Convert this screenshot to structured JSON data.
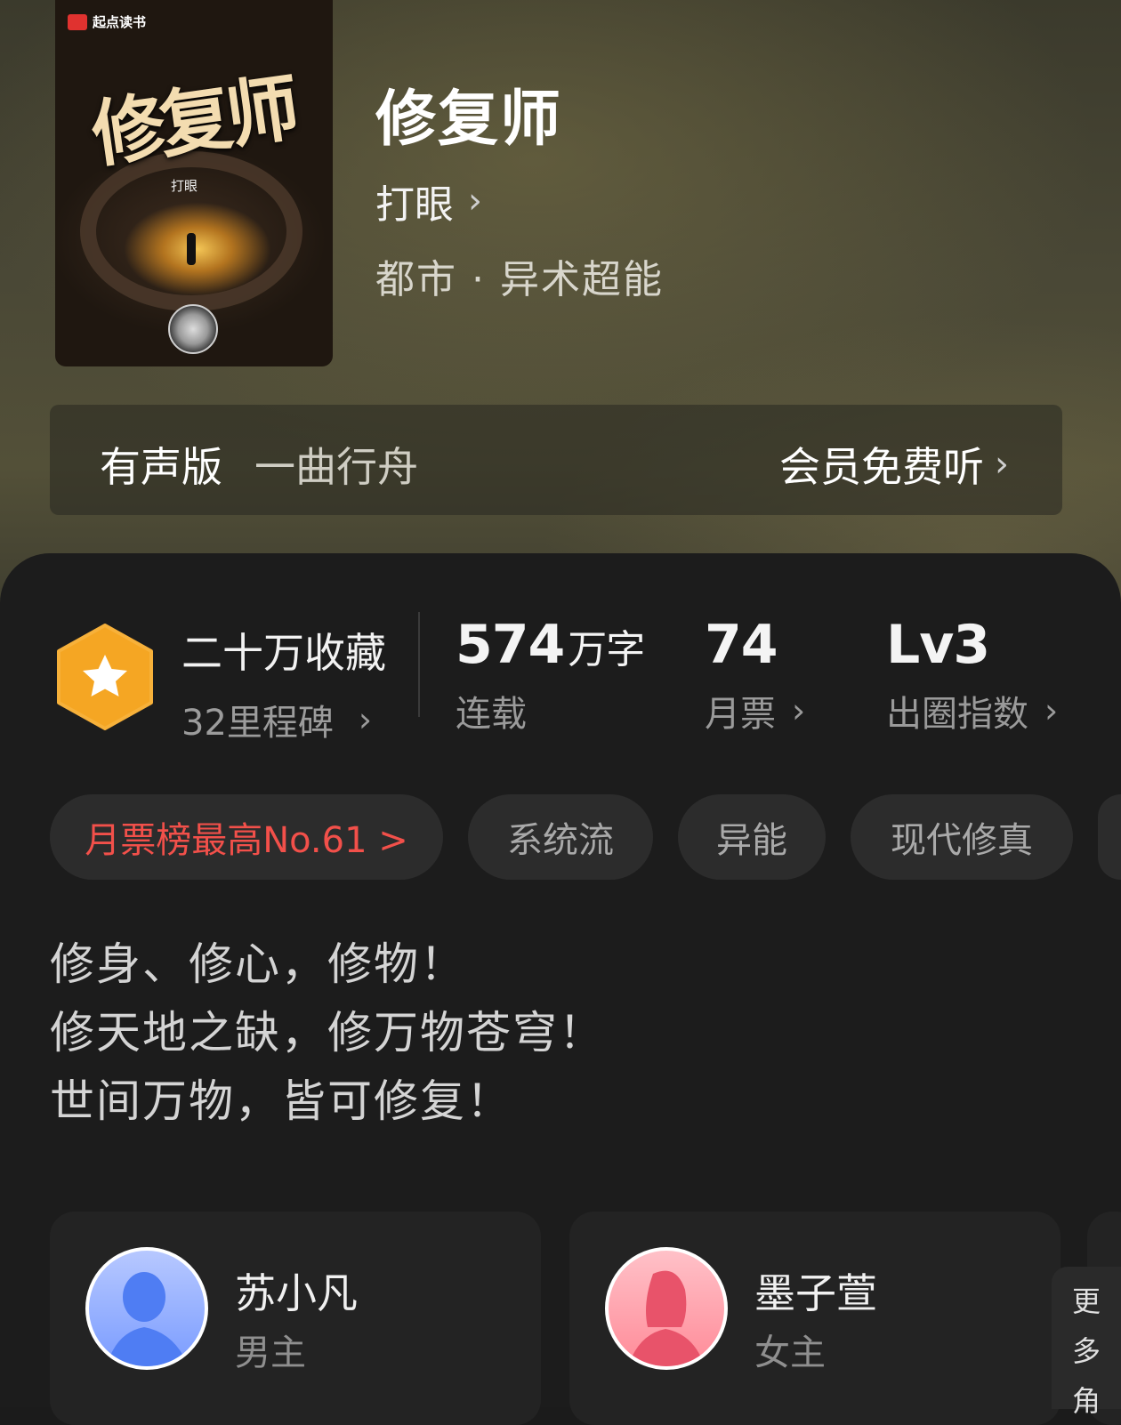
{
  "book": {
    "title": "修复师",
    "author": "打眼",
    "genre": "都市 · 异术超能",
    "cover": {
      "brand": "起点读书",
      "title": "修复师",
      "author": "打眼"
    }
  },
  "audio": {
    "label": "有声版",
    "narrator": "一曲行舟",
    "action": "会员免费听"
  },
  "stats": {
    "collections": "二十万收藏",
    "milestones": "32里程碑",
    "words_value": "574",
    "words_unit": "万字",
    "status": "连载",
    "monthly_votes": "74",
    "monthly_votes_label": "月票",
    "level": "Lv3",
    "level_label": "出圈指数"
  },
  "tags": [
    {
      "label": "月票榜最高No.61 >"
    },
    {
      "label": "系统流"
    },
    {
      "label": "异能"
    },
    {
      "label": "现代修真"
    }
  ],
  "intro": [
    "修身、修心，修物！",
    "修天地之缺，修万物苍穹！",
    "世间万物，皆可修复！"
  ],
  "characters": [
    {
      "name": "苏小凡",
      "role": "男主"
    },
    {
      "name": "墨子萱",
      "role": "女主"
    }
  ],
  "more_characters": [
    "更",
    "多",
    "角"
  ],
  "colors": {
    "accent_red": "#f2504a",
    "badge_orange": "#f5a623",
    "panel": "#1c1c1c"
  }
}
